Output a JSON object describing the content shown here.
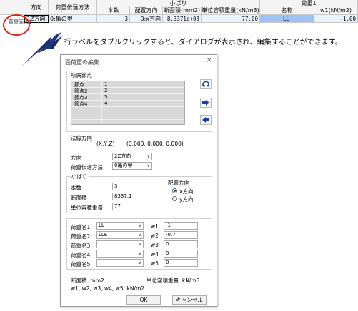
{
  "grid": {
    "headers": {
      "houkou": "方向",
      "denpatsu": "荷重伝達方法",
      "kobari": "小ばり",
      "honsuu": "本数",
      "haichi": "配置方向",
      "danmen": "断面積(mm2)",
      "taijuu": "単位容積重量(kN/m3)",
      "kajuu1": "荷重1",
      "meishou": "名称",
      "w1": "w1(kN/m2)"
    },
    "row": {
      "label": "荷重面積1",
      "houkou": "2Z方向",
      "denpatsu": "0:亀の甲",
      "honsuu": "3",
      "haichi": "0:x方向",
      "danmen": "8.3371e+03",
      "taijuu": "77.00",
      "meishou": "LL",
      "w1": "-1.00"
    }
  },
  "note": "行ラベルをダブルクリックすると、ダイアログが表示され、編集することができます。",
  "dialog": {
    "title": "面荷重の編集",
    "close": "×",
    "nodes_group": "所属節点",
    "nodes": [
      {
        "name": "節点1",
        "id": "1"
      },
      {
        "name": "節点2",
        "id": "2"
      },
      {
        "name": "節点3",
        "id": "5"
      },
      {
        "name": "節点4",
        "id": "4"
      }
    ],
    "normal_label": "法線方向",
    "normal_axes": "(X,Y,Z)",
    "normal_value": "(0.000, 0.000, 0.000)",
    "direction_label": "方向",
    "direction_value": "2Z方向",
    "transfer_label": "荷重伝達方法",
    "transfer_value": "0亀の甲",
    "kobari_group": "小ばり",
    "count_label": "本数",
    "count_value": "3",
    "area_label": "断面積",
    "area_value": "8337.1",
    "weight_label": "単位容積重量",
    "weight_value": "77",
    "placement_label": "配置方向",
    "x_dir": "x方向",
    "y_dir": "y方向",
    "loads": [
      {
        "label": "荷重名1",
        "name": "LL",
        "w": "w1",
        "value": "-1"
      },
      {
        "label": "荷重名2",
        "name": "LLE",
        "w": "w2",
        "value": "-0.7"
      },
      {
        "label": "荷重名3",
        "name": "",
        "w": "w3",
        "value": "0"
      },
      {
        "label": "荷重名4",
        "name": "",
        "w": "w4",
        "value": "0"
      },
      {
        "label": "荷重名5",
        "name": "",
        "w": "w5",
        "value": "0"
      }
    ],
    "unit_area": "断面積:  mm2",
    "unit_weight": "単位容積重量:  kN/m3",
    "unit_w": "w1, w2, w3, w4, w5:  kN/m2",
    "ok": "OK",
    "cancel": "キャンセル"
  }
}
